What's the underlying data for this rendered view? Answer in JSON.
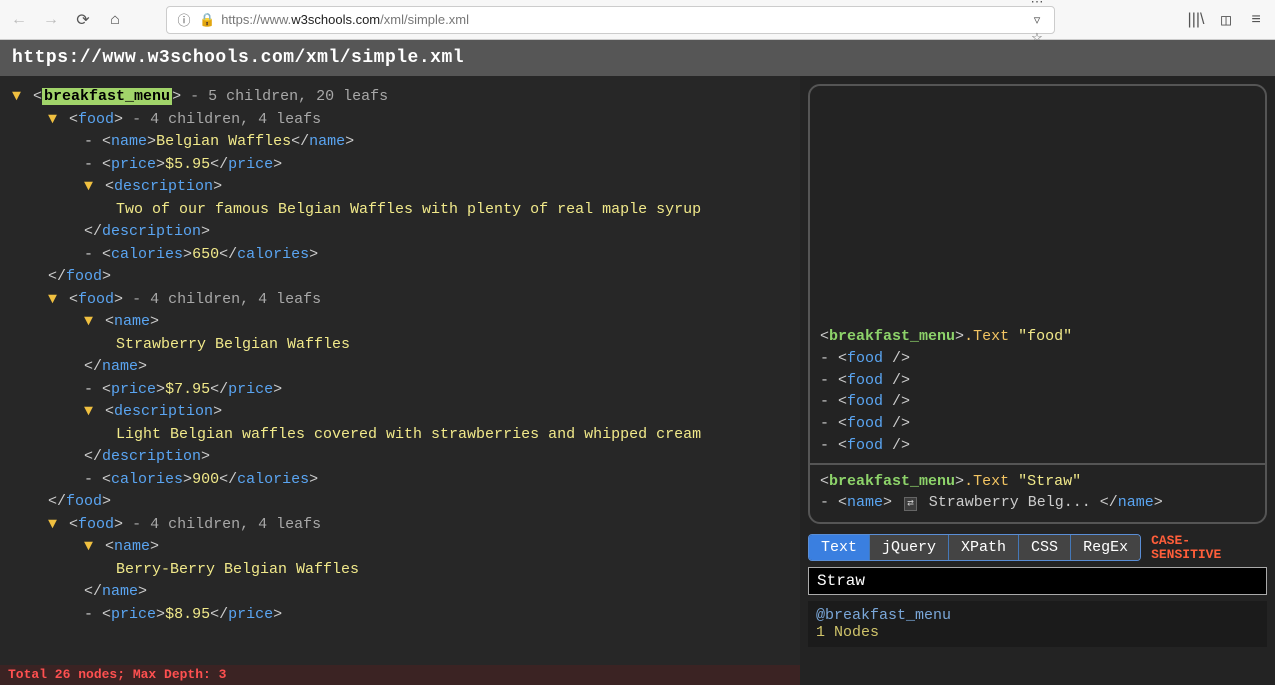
{
  "browser": {
    "url_prefix": "https://www.",
    "url_host": "w3schools.com",
    "url_path": "/xml/simple.xml"
  },
  "header": {
    "title": "https://www.w3schools.com/xml/simple.xml"
  },
  "tree": {
    "root_tag": "breakfast_menu",
    "root_meta": " - 5 children, 20 leafs",
    "food_tag": "food",
    "food_meta": " - 4 children, 4 leafs",
    "name_tag": "name",
    "price_tag": "price",
    "desc_tag": "description",
    "cal_tag": "calories",
    "items": [
      {
        "name": "Belgian Waffles",
        "price": "$5.95",
        "description": "Two of our famous Belgian Waffles with plenty of real maple syrup",
        "calories": "650"
      },
      {
        "name": "Strawberry Belgian Waffles",
        "price": "$7.95",
        "description": "Light Belgian waffles covered with strawberries and whipped cream",
        "calories": "900"
      },
      {
        "name": "Berry-Berry Belgian Waffles",
        "price": "$8.95",
        "description": "",
        "calories": ""
      }
    ]
  },
  "status": {
    "text": "Total 26 nodes; Max Depth: 3"
  },
  "results": {
    "query1_root": "breakfast_menu",
    "query1_method": ".Text ",
    "query1_quote": "\"food\"",
    "food_self": "food",
    "food_count": 5,
    "query2_root": "breakfast_menu",
    "query2_method": ".Text ",
    "query2_quote": "\"Straw\"",
    "match_tag": "name",
    "match_text": "Strawberry Belg..."
  },
  "tabs": {
    "items": [
      "Text",
      "jQuery",
      "XPath",
      "CSS",
      "RegEx"
    ],
    "active": 0,
    "case_line1": "CASE-",
    "case_line2": "SENSITIVE"
  },
  "search": {
    "value": "Straw"
  },
  "hints": {
    "context": "@breakfast_menu",
    "count_num": "1",
    "count_label": " Nodes"
  }
}
